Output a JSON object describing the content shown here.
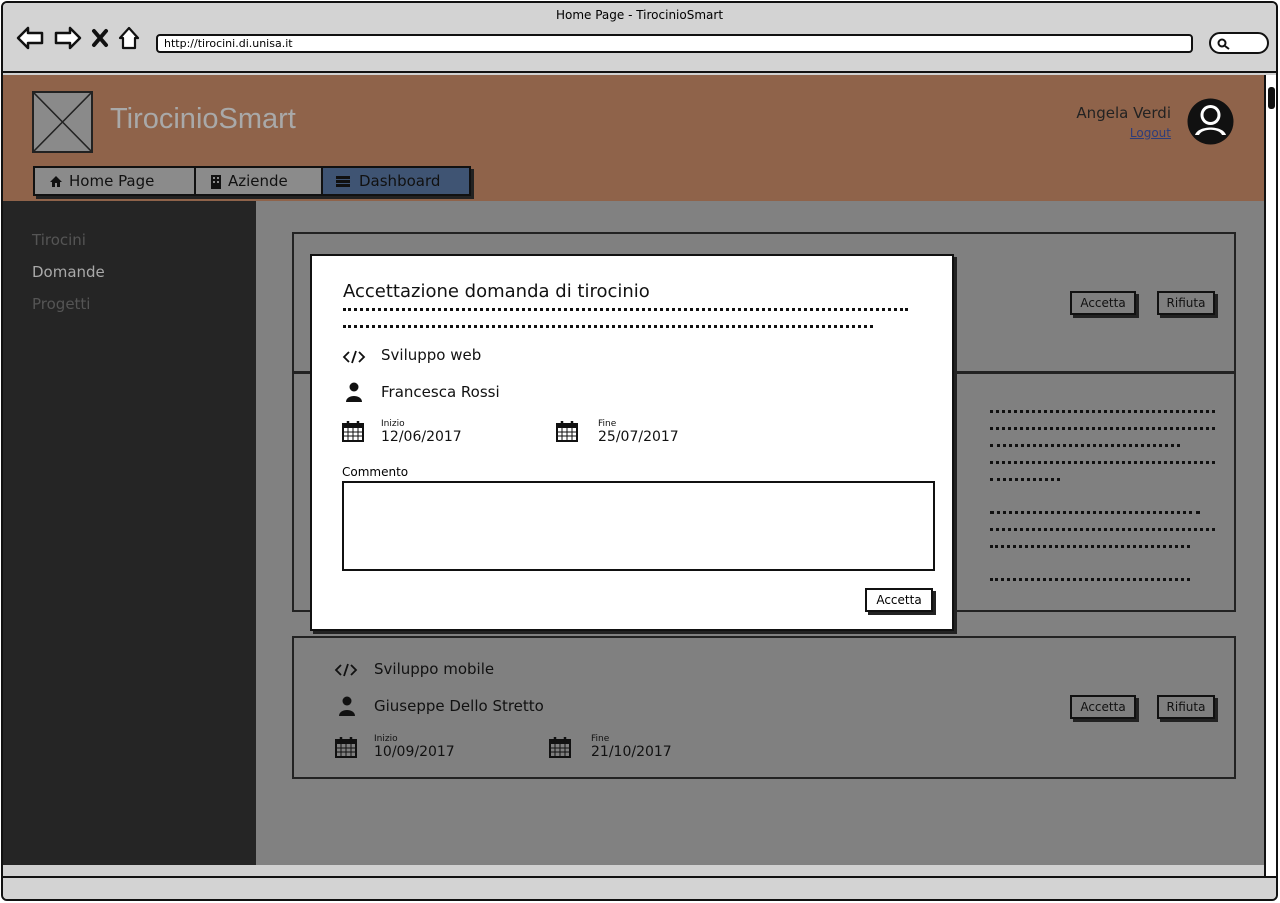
{
  "window": {
    "title": "Home Page - TirocinioSmart",
    "url": "http://tirocini.di.unisa.it"
  },
  "header": {
    "brand": "TirocinioSmart",
    "user_name": "Angela Verdi",
    "logout": "Logout",
    "tabs": [
      {
        "label": "Home Page",
        "icon": "home-icon"
      },
      {
        "label": "Aziende",
        "icon": "building-icon"
      },
      {
        "label": "Dashboard",
        "icon": "dashboard-icon"
      }
    ]
  },
  "sidebar": {
    "items": [
      {
        "label": "Tirocini"
      },
      {
        "label": "Domande"
      },
      {
        "label": "Progetti"
      }
    ]
  },
  "cards": [
    {
      "accept": "Accetta",
      "reject": "Rifiuta"
    },
    {
      "field": "Sviluppo mobile",
      "student": "Giuseppe Dello Stretto",
      "start_label": "Inizio",
      "start": "10/09/2017",
      "end_label": "Fine",
      "end": "21/10/2017",
      "accept": "Accetta",
      "reject": "Rifiuta"
    }
  ],
  "modal": {
    "title": "Accettazione domanda di tirocinio",
    "field": "Sviluppo web",
    "student": "Francesca Rossi",
    "start_label": "Inizio",
    "start": "12/06/2017",
    "end_label": "Fine",
    "end": "25/07/2017",
    "comment_label": "Commento",
    "accept": "Accetta"
  },
  "colors": {
    "header": "#8f634a",
    "sidebar": "#252525",
    "active_tab": "#3f5473",
    "overlay": "#818181"
  }
}
